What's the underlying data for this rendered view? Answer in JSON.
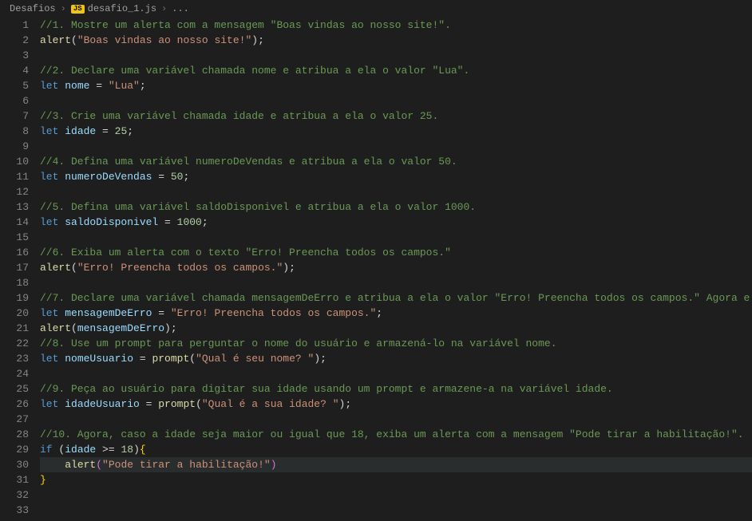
{
  "breadcrumb": {
    "folder": "Desafios",
    "badge": "JS",
    "file": "desafio_1.js",
    "trail": "..."
  },
  "chart_data": null,
  "lines": [
    [
      {
        "c": "tok-comment",
        "t": "//1. Mostre um alerta com a mensagem \"Boas vindas ao nosso site!\"."
      }
    ],
    [
      {
        "c": "tok-func",
        "t": "alert"
      },
      {
        "c": "tok-punct",
        "t": "("
      },
      {
        "c": "tok-string",
        "t": "\"Boas vindas ao nosso site!\""
      },
      {
        "c": "tok-punct",
        "t": ");"
      }
    ],
    [],
    [
      {
        "c": "tok-comment",
        "t": "//2. Declare uma variável chamada nome e atribua a ela o valor \"Lua\"."
      }
    ],
    [
      {
        "c": "tok-keyword",
        "t": "let "
      },
      {
        "c": "tok-var",
        "t": "nome"
      },
      {
        "c": "tok-op",
        "t": " = "
      },
      {
        "c": "tok-string",
        "t": "\"Lua\""
      },
      {
        "c": "tok-punct",
        "t": ";"
      }
    ],
    [],
    [
      {
        "c": "tok-comment",
        "t": "//3. Crie uma variável chamada idade e atribua a ela o valor 25."
      }
    ],
    [
      {
        "c": "tok-keyword",
        "t": "let "
      },
      {
        "c": "tok-var",
        "t": "idade"
      },
      {
        "c": "tok-op",
        "t": " = "
      },
      {
        "c": "tok-num",
        "t": "25"
      },
      {
        "c": "tok-punct",
        "t": ";"
      }
    ],
    [],
    [
      {
        "c": "tok-comment",
        "t": "//4. Defina uma variável numeroDeVendas e atribua a ela o valor 50."
      }
    ],
    [
      {
        "c": "tok-keyword",
        "t": "let "
      },
      {
        "c": "tok-var",
        "t": "numeroDeVendas"
      },
      {
        "c": "tok-op",
        "t": " = "
      },
      {
        "c": "tok-num",
        "t": "50"
      },
      {
        "c": "tok-punct",
        "t": ";"
      }
    ],
    [],
    [
      {
        "c": "tok-comment",
        "t": "//5. Defina uma variável saldoDisponivel e atribua a ela o valor 1000."
      }
    ],
    [
      {
        "c": "tok-keyword",
        "t": "let "
      },
      {
        "c": "tok-var",
        "t": "saldoDisponivel"
      },
      {
        "c": "tok-op",
        "t": " = "
      },
      {
        "c": "tok-num",
        "t": "1000"
      },
      {
        "c": "tok-punct",
        "t": ";"
      }
    ],
    [],
    [
      {
        "c": "tok-comment",
        "t": "//6. Exiba um alerta com o texto \"Erro! Preencha todos os campos.\""
      }
    ],
    [
      {
        "c": "tok-func",
        "t": "alert"
      },
      {
        "c": "tok-punct",
        "t": "("
      },
      {
        "c": "tok-string",
        "t": "\"Erro! Preencha todos os campos.\""
      },
      {
        "c": "tok-punct",
        "t": ");"
      }
    ],
    [],
    [
      {
        "c": "tok-comment",
        "t": "//7. Declare uma variável chamada mensagemDeErro e atribua a ela o valor \"Erro! Preencha todos os campos.\" Agora e"
      }
    ],
    [
      {
        "c": "tok-keyword",
        "t": "let "
      },
      {
        "c": "tok-var",
        "t": "mensagemDeErro"
      },
      {
        "c": "tok-op",
        "t": " = "
      },
      {
        "c": "tok-string",
        "t": "\"Erro! Preencha todos os campos.\""
      },
      {
        "c": "tok-punct",
        "t": ";"
      }
    ],
    [
      {
        "c": "tok-func",
        "t": "alert"
      },
      {
        "c": "tok-punct",
        "t": "("
      },
      {
        "c": "tok-var",
        "t": "mensagemDeErro"
      },
      {
        "c": "tok-punct",
        "t": ");"
      }
    ],
    [
      {
        "c": "tok-comment",
        "t": "//8. Use um prompt para perguntar o nome do usuário e armazená-lo na variável nome."
      }
    ],
    [
      {
        "c": "tok-keyword",
        "t": "let "
      },
      {
        "c": "tok-var",
        "t": "nomeUsuario"
      },
      {
        "c": "tok-op",
        "t": " = "
      },
      {
        "c": "tok-func",
        "t": "prompt"
      },
      {
        "c": "tok-punct",
        "t": "("
      },
      {
        "c": "tok-string",
        "t": "\"Qual é seu nome? \""
      },
      {
        "c": "tok-punct",
        "t": ");"
      }
    ],
    [],
    [
      {
        "c": "tok-comment",
        "t": "//9. Peça ao usuário para digitar sua idade usando um prompt e armazene-a na variável idade."
      }
    ],
    [
      {
        "c": "tok-keyword",
        "t": "let "
      },
      {
        "c": "tok-var",
        "t": "idadeUsuario"
      },
      {
        "c": "tok-op",
        "t": " = "
      },
      {
        "c": "tok-func",
        "t": "prompt"
      },
      {
        "c": "tok-punct",
        "t": "("
      },
      {
        "c": "tok-string",
        "t": "\"Qual é a sua idade? \""
      },
      {
        "c": "tok-punct",
        "t": ");"
      }
    ],
    [],
    [
      {
        "c": "tok-comment",
        "t": "//10. Agora, caso a idade seja maior ou igual que 18, exiba um alerta com a mensagem \"Pode tirar a habilitação!\"."
      }
    ],
    [
      {
        "c": "tok-keyword",
        "t": "if"
      },
      {
        "c": "tok-punct",
        "t": " ("
      },
      {
        "c": "tok-var",
        "t": "idade"
      },
      {
        "c": "tok-op",
        "t": " >= "
      },
      {
        "c": "tok-num",
        "t": "18"
      },
      {
        "c": "tok-punct",
        "t": ")"
      },
      {
        "c": "tok-brace",
        "t": "{"
      }
    ],
    [
      {
        "c": "tok-punct",
        "t": "    "
      },
      {
        "c": "tok-func",
        "t": "alert"
      },
      {
        "c": "tok-paren",
        "t": "("
      },
      {
        "c": "tok-string",
        "t": "\"Pode tirar a habilitação!\""
      },
      {
        "c": "tok-paren",
        "t": ")"
      }
    ],
    [
      {
        "c": "tok-brace",
        "t": "}"
      }
    ],
    [],
    []
  ],
  "highlightLine": 30
}
